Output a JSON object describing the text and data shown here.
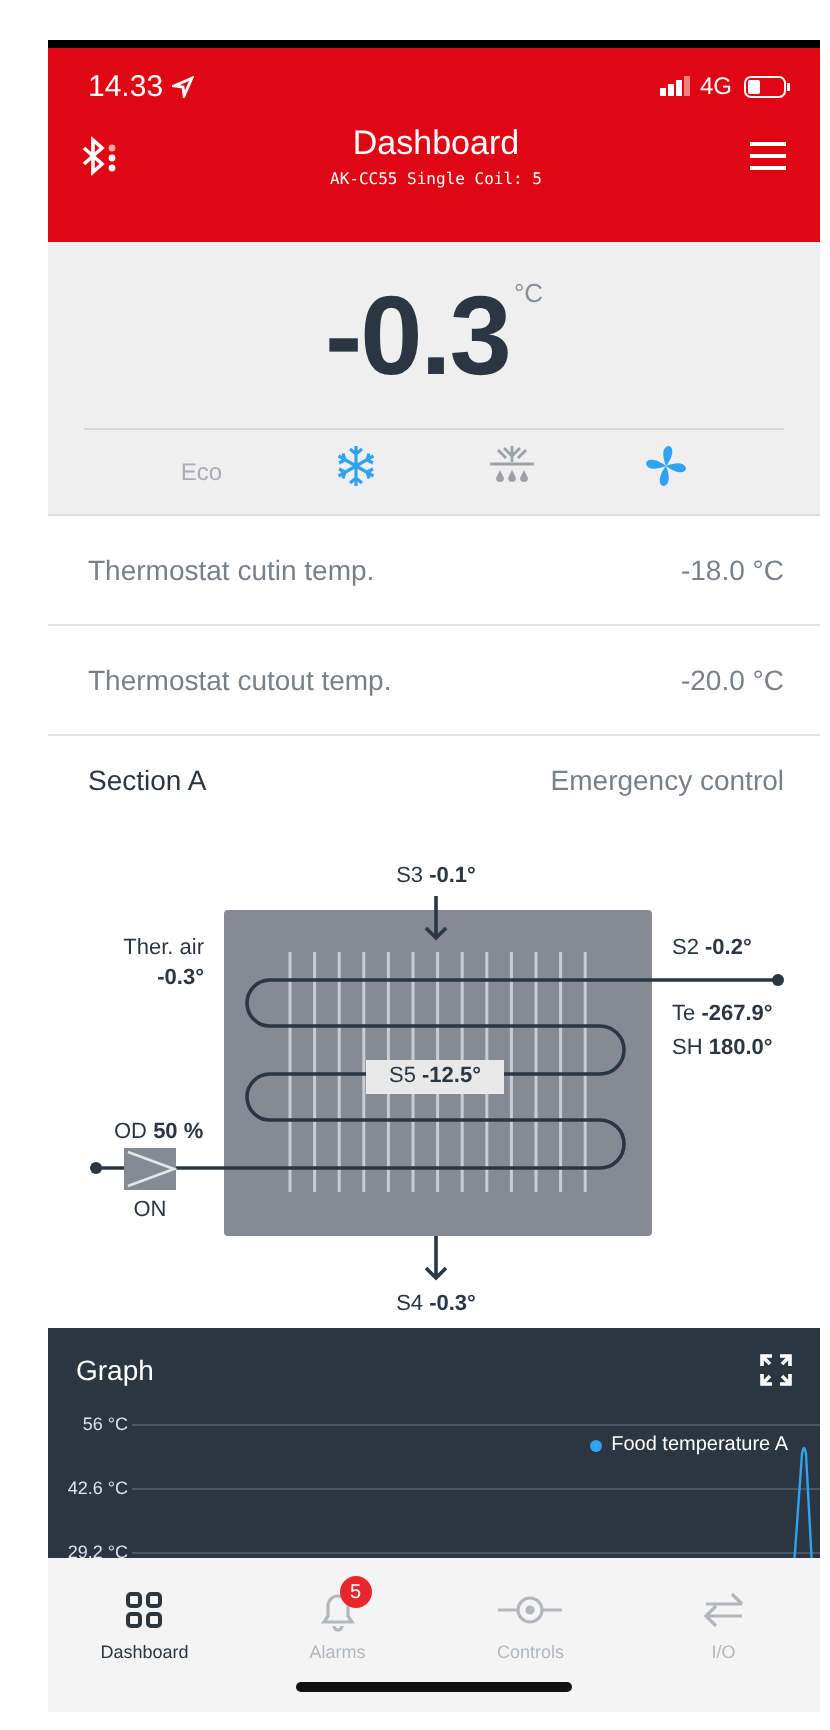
{
  "status_bar": {
    "time": "14.33",
    "network": "4G"
  },
  "header": {
    "title": "Dashboard",
    "subtitle": "AK-CC55 Single Coil: 5"
  },
  "reading": {
    "value": "-0.3",
    "unit": "°C"
  },
  "modes": [
    {
      "kind": "text",
      "label": "Eco",
      "on": false
    },
    {
      "kind": "cooling",
      "on": true
    },
    {
      "kind": "defrost",
      "on": false
    },
    {
      "kind": "fan",
      "on": true
    }
  ],
  "settings": [
    {
      "label": "Thermostat cutin temp.",
      "value": "-18.0 °C"
    },
    {
      "label": "Thermostat cutout temp.",
      "value": "-20.0 °C"
    }
  ],
  "section": {
    "title": "Section A",
    "action": "Emergency control"
  },
  "evaporator": {
    "s3": "S3 **-0.1°**",
    "s4": "S4 **-0.3°**",
    "ther_air": [
      "Ther. air",
      "**-0.3°**"
    ],
    "s2": "S2 **-0.2°**",
    "te": "Te **-267.9°**",
    "sh": "SH **180.0°**",
    "s5": "S5 **-12.5°**",
    "valve_opening": "OD **50 %**",
    "valve_state": "ON"
  },
  "graph": {
    "title": "Graph",
    "y_labels": [
      "56 °C",
      "42.6 °C",
      "29.2 °C"
    ],
    "legend": {
      "label": "Food temperature A",
      "color": "#2ea3f2"
    }
  },
  "nav": [
    {
      "kind": "dashboard",
      "label": "Dashboard",
      "selected": true
    },
    {
      "kind": "alarms",
      "label": "Alarms",
      "selected": false,
      "badge": "5"
    },
    {
      "kind": "controls",
      "label": "Controls",
      "selected": false
    },
    {
      "kind": "io",
      "label": "I/O",
      "selected": false
    }
  ]
}
